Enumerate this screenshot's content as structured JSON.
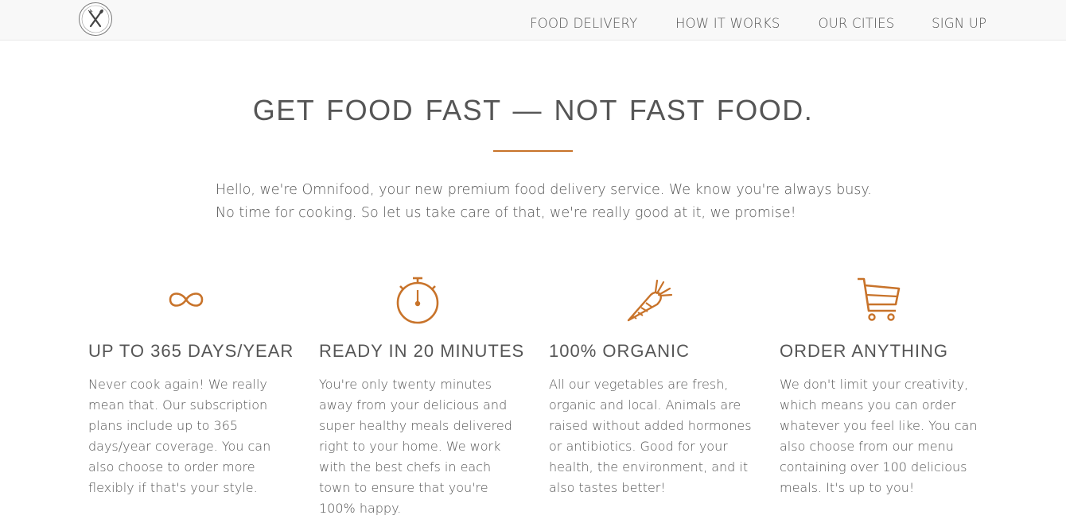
{
  "brand": {
    "logo_icon": "fork-knife-logo",
    "accent_color": "#c8732a"
  },
  "nav": {
    "items": [
      {
        "label": "FOOD DELIVERY"
      },
      {
        "label": "HOW IT WORKS"
      },
      {
        "label": "OUR CITIES"
      },
      {
        "label": "SIGN UP"
      }
    ]
  },
  "hero": {
    "headline": "GET FOOD FAST — NOT FAST FOOD.",
    "intro_lines": [
      "Hello, we're Omnifood, your new premium food delivery service. We know you're always busy.",
      "No time for cooking. So let us take care of that, we're really good at it, we promise!"
    ]
  },
  "features": [
    {
      "icon": "infinity-icon",
      "title": "UP TO 365 DAYS/YEAR",
      "text": "Never cook again! We really mean that. Our subscription plans include up to 365 days/year coverage. You can also choose to order more flexibly if that's your style."
    },
    {
      "icon": "stopwatch-icon",
      "title": "READY IN 20 MINUTES",
      "text": "You're only twenty minutes away from your delicious and super healthy meals delivered right to your home. We work with the best chefs in each town to ensure that you're 100% happy."
    },
    {
      "icon": "carrot-icon",
      "title": "100% ORGANIC",
      "text": "All our vegetables are fresh, organic and local. Animals are raised without added hormones or antibiotics. Good for your health, the environment, and it also tastes better!"
    },
    {
      "icon": "cart-icon",
      "title": "ORDER ANYTHING",
      "text": "We don't limit your creativity, which means you can order whatever you feel like. You can also choose from our menu containing over 100 delicious meals. It's up to you!"
    }
  ]
}
